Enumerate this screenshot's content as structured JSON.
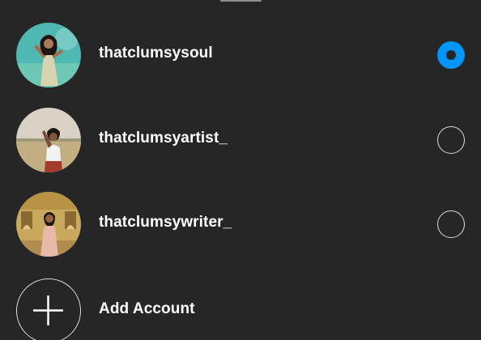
{
  "accounts": [
    {
      "username": "thatclumsysoul",
      "selected": true,
      "avatar": "profile-photo-woman-teal-backdrop"
    },
    {
      "username": "thatclumsyartist_",
      "selected": false,
      "avatar": "profile-photo-woman-field"
    },
    {
      "username": "thatclumsywriter_",
      "selected": false,
      "avatar": "profile-photo-woman-palace"
    }
  ],
  "add_account": {
    "label": "Add Account",
    "icon": "plus-icon"
  },
  "colors": {
    "background": "#262626",
    "text": "#ffffff",
    "accent": "#0095f6",
    "radio_outline": "#dbdbdb"
  }
}
